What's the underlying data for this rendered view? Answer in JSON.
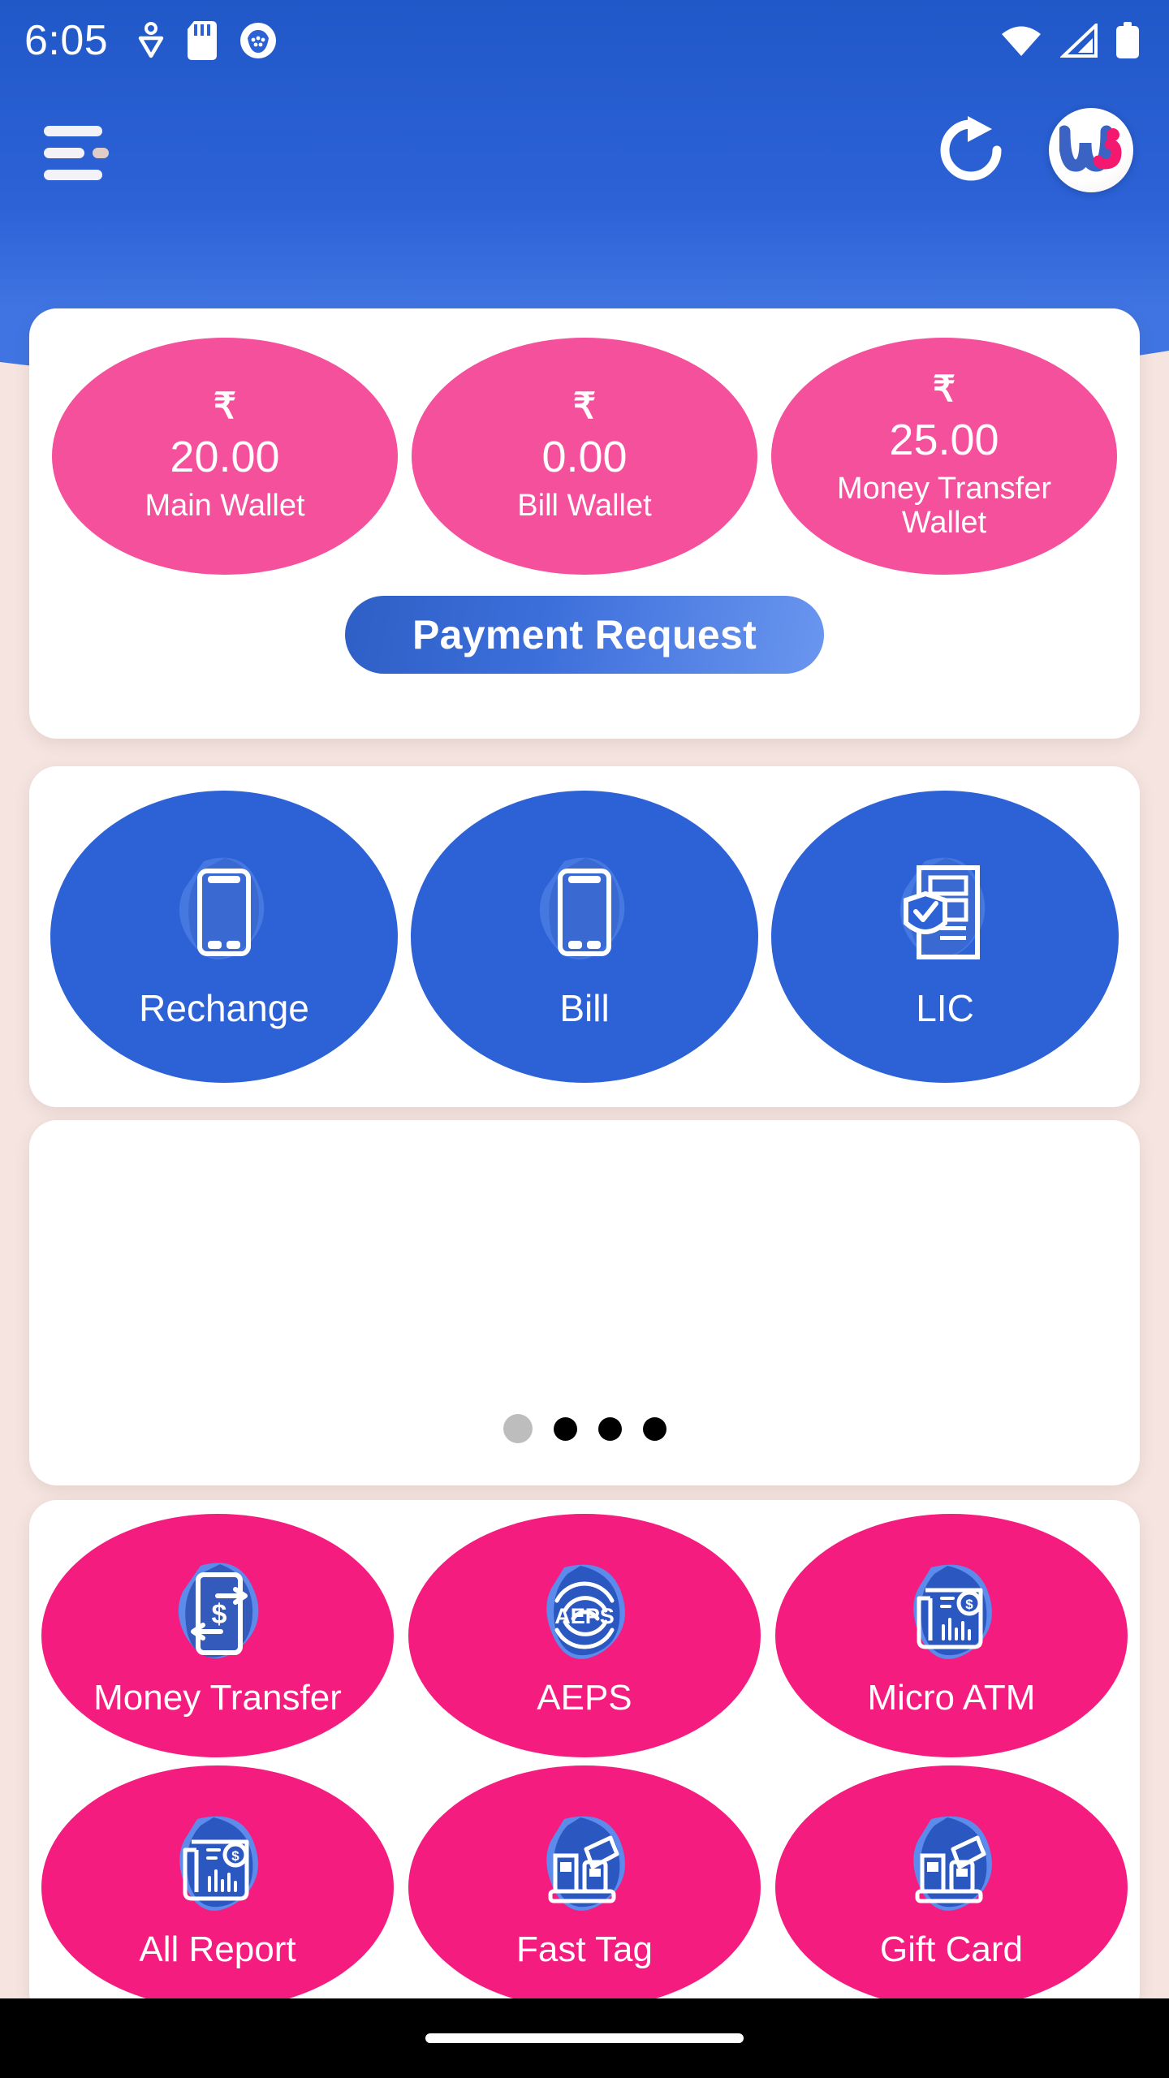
{
  "status_bar": {
    "time": "6:05",
    "left_icons": [
      "location-heart-icon",
      "sd-card-icon",
      "app-notification-icon"
    ],
    "right_icons": [
      "wifi-icon",
      "cellular-signal-icon",
      "battery-full-icon"
    ]
  },
  "app_bar": {
    "menu_icon": "hamburger-menu-icon",
    "refresh_icon": "refresh-icon",
    "logo": "wi-brand-logo"
  },
  "wallet_card": {
    "currency_symbol": "₹",
    "wallets": [
      {
        "amount": "20.00",
        "label": "Main Wallet"
      },
      {
        "amount": "0.00",
        "label": "Bill Wallet"
      },
      {
        "amount": "25.00",
        "label": "Money Transfer Wallet"
      }
    ],
    "payment_request_label": "Payment Request"
  },
  "services": [
    {
      "label": "Rechange",
      "icon": "smartphone-icon"
    },
    {
      "label": "Bill",
      "icon": "smartphone-icon"
    },
    {
      "label": "LIC",
      "icon": "document-shield-icon"
    }
  ],
  "banner": {
    "dots_total": 4,
    "active_dot_index": 0
  },
  "grid_items": [
    {
      "label": "Money Transfer",
      "icon": "phone-money-transfer-icon"
    },
    {
      "label": "AEPS",
      "icon": "fingerprint-aeps-icon"
    },
    {
      "label": "Micro ATM",
      "icon": "report-money-icon"
    },
    {
      "label": "All Report",
      "icon": "report-money-icon"
    },
    {
      "label": "Fast Tag",
      "icon": "card-swipe-terminal-icon"
    },
    {
      "label": "Gift Card",
      "icon": "card-swipe-terminal-icon"
    }
  ],
  "colors": {
    "header_blue": "#2c62d6",
    "page_background": "#f5e4e0",
    "wallet_pink": "#f5509b",
    "grid_pink": "#f51c80",
    "service_blue": "#2c62d6",
    "card_white": "#ffffff"
  },
  "bottom_nav": {
    "home_indicator": "home-indicator"
  }
}
